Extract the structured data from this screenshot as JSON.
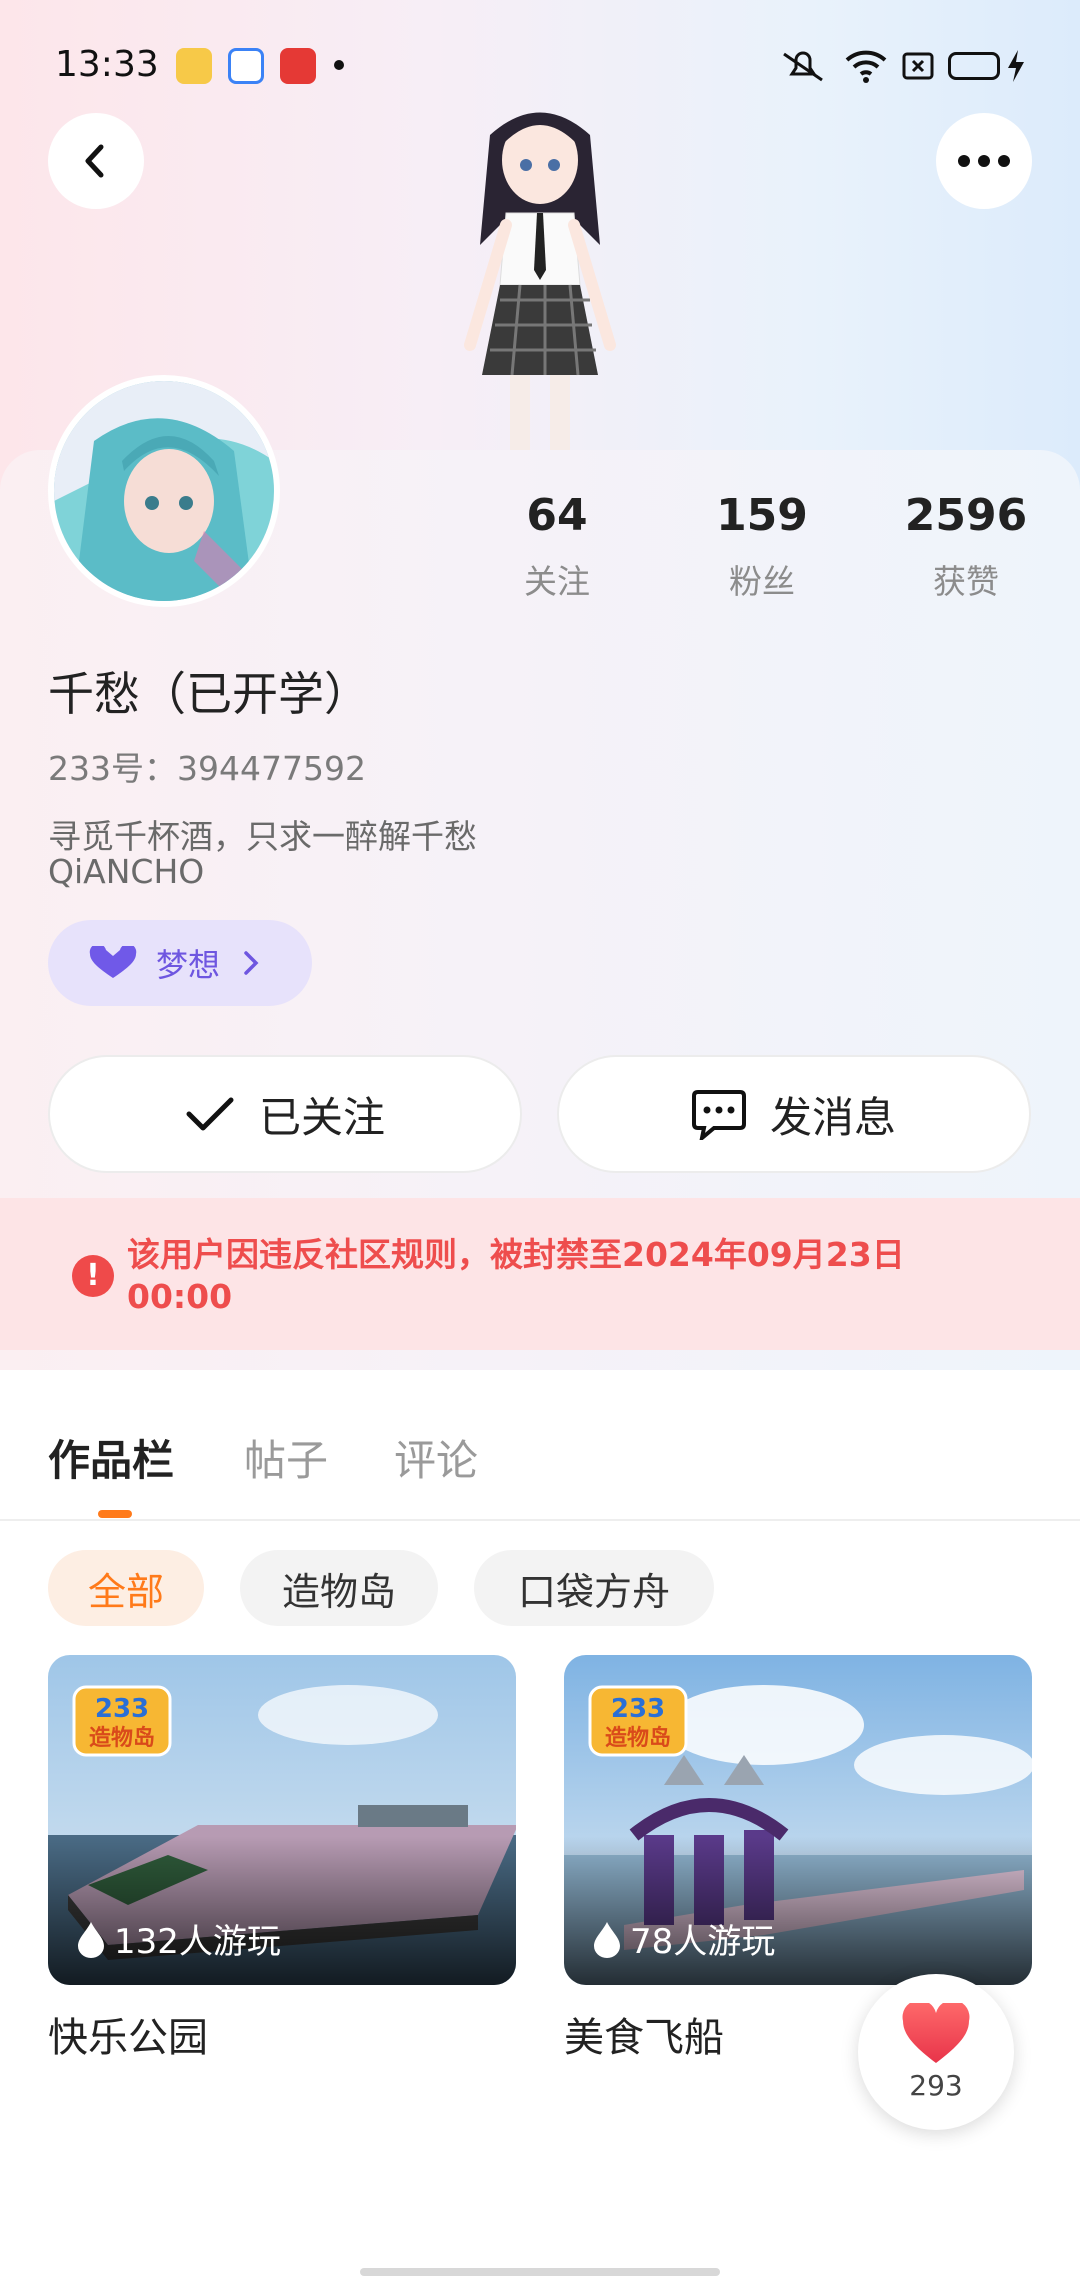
{
  "status_bar": {
    "time": "13:33",
    "icons": [
      "weibo-icon",
      "app-icon",
      "video-icon",
      "mute-icon",
      "wifi-icon",
      "sim-icon",
      "battery-icon",
      "charging-icon"
    ]
  },
  "colors": {
    "accent": "#ff7a1a",
    "ban_text": "#ee4d4d",
    "dream_purple": "#6e56e0"
  },
  "profile": {
    "stats": [
      {
        "value": "64",
        "label": "关注"
      },
      {
        "value": "159",
        "label": "粉丝"
      },
      {
        "value": "2596",
        "label": "获赞"
      }
    ],
    "name": "千愁（已开学）",
    "uid": "233号：394477592",
    "bio_lines": [
      "寻觅千杯酒，只求一醉解千愁",
      "QiANCHO"
    ],
    "tag": "梦想"
  },
  "actions": {
    "follow_label": "已关注",
    "message_label": "发消息"
  },
  "ban_notice": "该用户因违反社区规则，被封禁至2024年09月23日 00:00",
  "tabs": [
    "作品栏",
    "帖子",
    "评论"
  ],
  "filters": [
    "全部",
    "造物岛",
    "口袋方舟"
  ],
  "works": [
    {
      "title": "快乐公园",
      "plays": "132人游玩",
      "badge_top": "233",
      "badge_bottom": "造物岛"
    },
    {
      "title": "美食飞船",
      "plays": "78人游玩",
      "badge_top": "233",
      "badge_bottom": "造物岛"
    }
  ],
  "like": {
    "count": "293"
  }
}
